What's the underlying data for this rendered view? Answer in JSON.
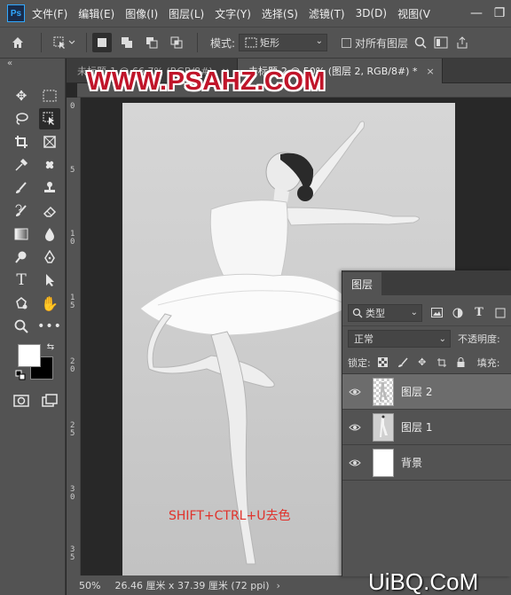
{
  "app": {
    "logo": "Ps",
    "menus": [
      "文件(F)",
      "编辑(E)",
      "图像(I)",
      "图层(L)",
      "文字(Y)",
      "选择(S)",
      "滤镜(T)",
      "3D(D)",
      "视图(V"
    ],
    "window_buttons": [
      "—",
      "❐"
    ]
  },
  "options_bar": {
    "mode_label": "模式:",
    "mode_value": "矩形",
    "sample_all_label": "对所有图层"
  },
  "tabs": [
    {
      "label": "未标题-1 @ 66.7% (RGB/8#)"
    },
    {
      "label": "未标题-2 @ 50% (图层 2, RGB/8#) *"
    }
  ],
  "ruler_left_numbers": [
    "0",
    "5",
    "1\n0",
    "1\n5",
    "2\n0",
    "2\n5",
    "3\n0",
    "3\n5"
  ],
  "canvas": {
    "instruction_text": "SHIFT+CTRL+U去色"
  },
  "watermark": {
    "top": "WWW.PSAHZ.COM",
    "bottom": "UiBQ.CoM"
  },
  "status": {
    "zoom": "50%",
    "doc_size": "26.46 厘米 x 37.39 厘米 (72 ppi)"
  },
  "layers_panel": {
    "tab_label": "图层",
    "kind_filter": "类型",
    "blend_mode": "正常",
    "opacity_label": "不透明度:",
    "lock_label": "锁定:",
    "fill_label": "填充:",
    "layers": [
      {
        "name": "图层 2",
        "selected": true
      },
      {
        "name": "图层 1",
        "selected": false
      },
      {
        "name": "背景",
        "selected": false
      }
    ]
  },
  "colors": {
    "foreground": "#ffffff",
    "background": "#000000",
    "accent": "#31a8ff",
    "instruction": "#e0322b"
  }
}
